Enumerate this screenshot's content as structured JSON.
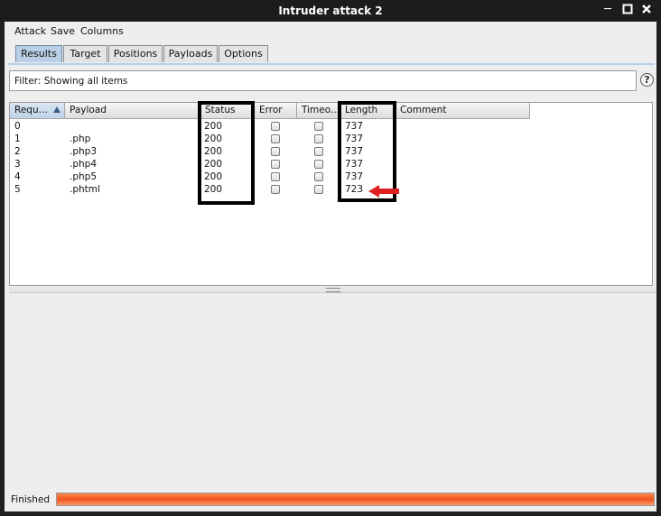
{
  "window": {
    "title": "Intruder attack 2",
    "controls": [
      "minimize",
      "maximize",
      "close"
    ]
  },
  "menu": [
    "Attack",
    "Save",
    "Columns"
  ],
  "tabs": [
    {
      "label": "Results",
      "active": true
    },
    {
      "label": "Target",
      "active": false
    },
    {
      "label": "Positions",
      "active": false
    },
    {
      "label": "Payloads",
      "active": false
    },
    {
      "label": "Options",
      "active": false
    }
  ],
  "filter": {
    "text": "Filter:  Showing all items",
    "help_icon": "question-mark"
  },
  "table": {
    "columns": [
      "Requ...",
      "Payload",
      "Status",
      "Error",
      "Timeo...",
      "Length",
      "Comment"
    ],
    "sorted_column": "Requ...",
    "sort_direction": "ascending",
    "rows": [
      {
        "request": "0",
        "payload": "",
        "status": "200",
        "error": false,
        "timeout": false,
        "length": "737",
        "comment": ""
      },
      {
        "request": "1",
        "payload": ".php",
        "status": "200",
        "error": false,
        "timeout": false,
        "length": "737",
        "comment": ""
      },
      {
        "request": "2",
        "payload": ".php3",
        "status": "200",
        "error": false,
        "timeout": false,
        "length": "737",
        "comment": ""
      },
      {
        "request": "3",
        "payload": ".php4",
        "status": "200",
        "error": false,
        "timeout": false,
        "length": "737",
        "comment": ""
      },
      {
        "request": "4",
        "payload": ".php5",
        "status": "200",
        "error": false,
        "timeout": false,
        "length": "737",
        "comment": ""
      },
      {
        "request": "5",
        "payload": ".phtml",
        "status": "200",
        "error": false,
        "timeout": false,
        "length": "723",
        "comment": ""
      }
    ]
  },
  "annotations": {
    "highlight_color": "#000000",
    "arrow_color": "#e02020",
    "highlighted_columns": [
      "Status",
      "Length"
    ]
  },
  "status": {
    "text": "Finished",
    "progress": 1.0,
    "progress_color": "#f0541f"
  }
}
